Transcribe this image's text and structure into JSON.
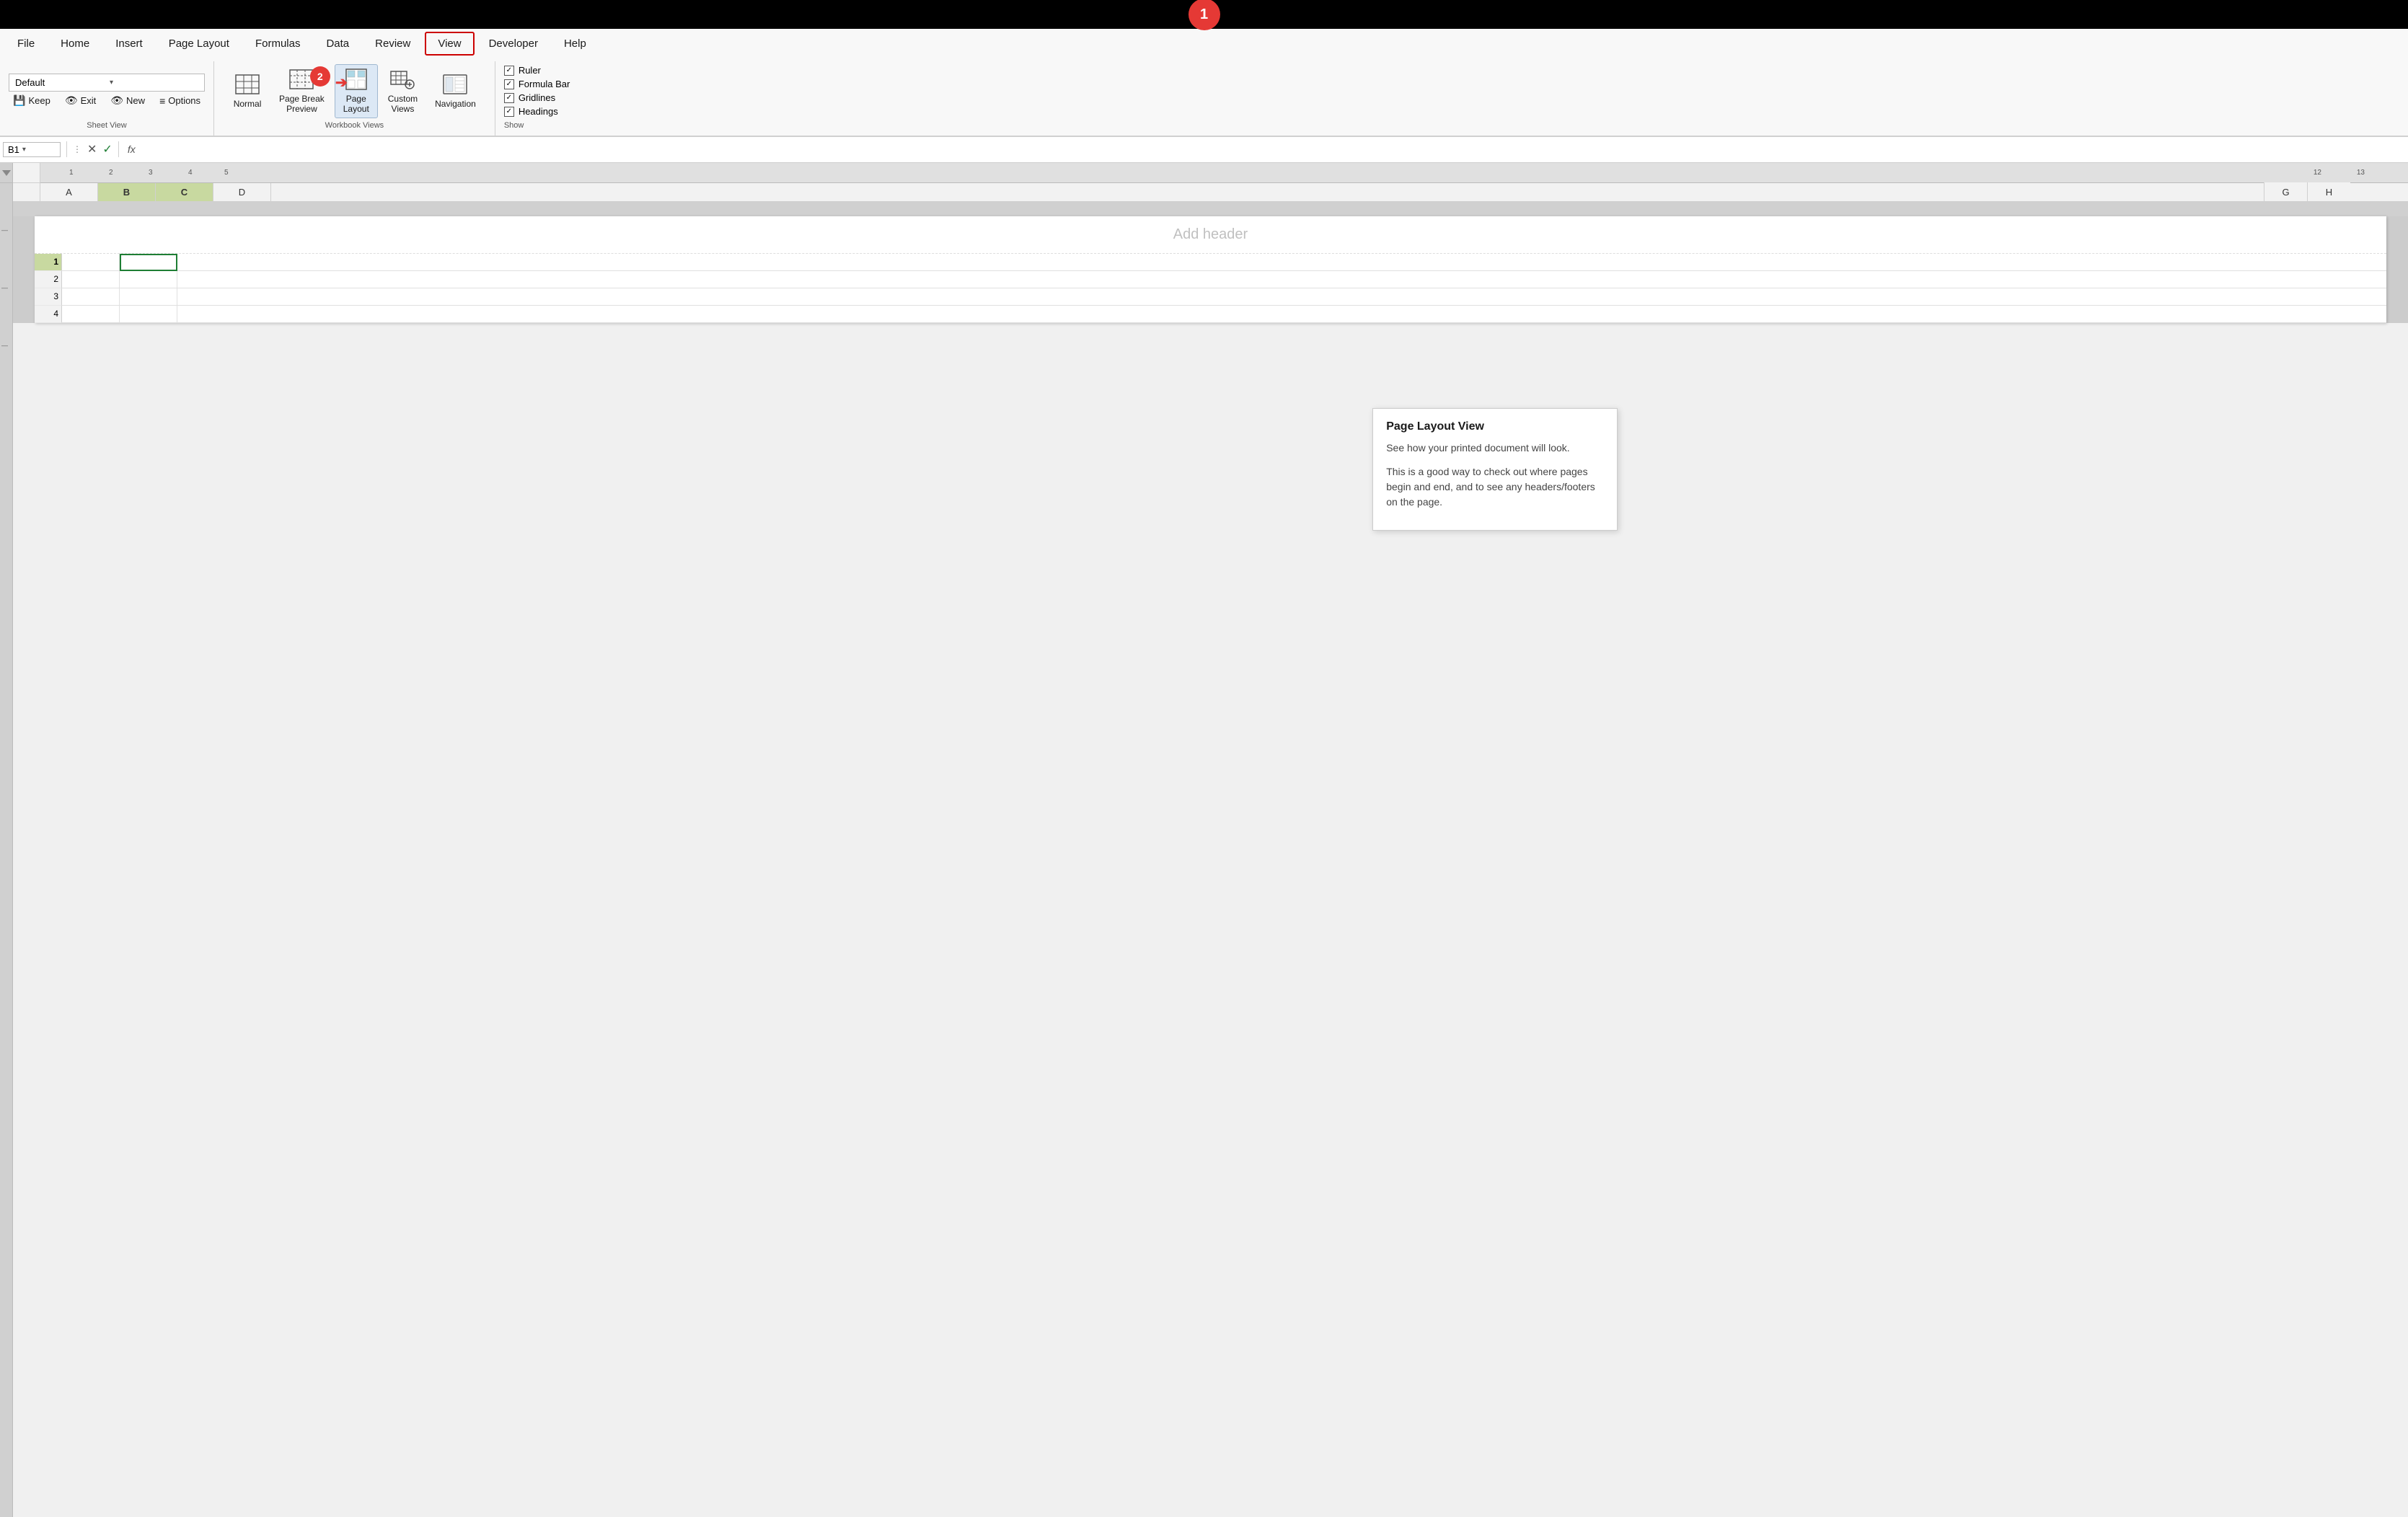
{
  "titleBar": {
    "stepCircle": "1"
  },
  "menuBar": {
    "items": [
      {
        "label": "File",
        "active": false
      },
      {
        "label": "Home",
        "active": false
      },
      {
        "label": "Insert",
        "active": false
      },
      {
        "label": "Page Layout",
        "active": false
      },
      {
        "label": "Formulas",
        "active": false
      },
      {
        "label": "Data",
        "active": false
      },
      {
        "label": "Review",
        "active": false
      },
      {
        "label": "View",
        "active": true
      },
      {
        "label": "Developer",
        "active": false
      },
      {
        "label": "Help",
        "active": false
      }
    ]
  },
  "sheetView": {
    "label": "Sheet View",
    "dropdown": "Default",
    "dropdownArrow": "▾",
    "buttons": [
      {
        "icon": "💾",
        "label": "Keep"
      },
      {
        "icon": "👁",
        "label": "Exit"
      },
      {
        "icon": "👁",
        "label": "New"
      },
      {
        "icon": "≡",
        "label": "Options"
      }
    ]
  },
  "workbookViews": {
    "label": "Workbook Views",
    "stepCircle": "2",
    "buttons": [
      {
        "id": "normal",
        "label": "Normal"
      },
      {
        "id": "pagebreak",
        "label": "Page Break\nPreview"
      },
      {
        "id": "pagelayout",
        "label": "Page\nLayout",
        "active": true
      },
      {
        "id": "customviews",
        "label": "Custom\nViews"
      },
      {
        "id": "navigation",
        "label": "Navigation"
      }
    ]
  },
  "show": {
    "label": "Show",
    "items": [
      {
        "label": "Ruler",
        "checked": true
      },
      {
        "label": "Formula Bar",
        "checked": true
      },
      {
        "label": "Gridlines",
        "checked": true
      },
      {
        "label": "Headings",
        "checked": true
      }
    ]
  },
  "formulaBar": {
    "nameBox": "B1",
    "cancelIcon": "✕",
    "confirmIcon": "✓",
    "fxLabel": "fx"
  },
  "tooltip": {
    "title": "Page Layout View",
    "para1": "See how your printed document will look.",
    "para2": "This is a good way to check out where pages begin and end, and to see any headers/footers on the page."
  },
  "spreadsheet": {
    "addHeaderText": "Add header",
    "colHeaders": [
      "A",
      "B",
      "C",
      "G",
      "H"
    ],
    "rowNumbers": [
      "1",
      "2",
      "3",
      "4"
    ],
    "rulerNumbers": [
      "1",
      "2",
      "3",
      "4",
      "5",
      "12",
      "13"
    ]
  }
}
